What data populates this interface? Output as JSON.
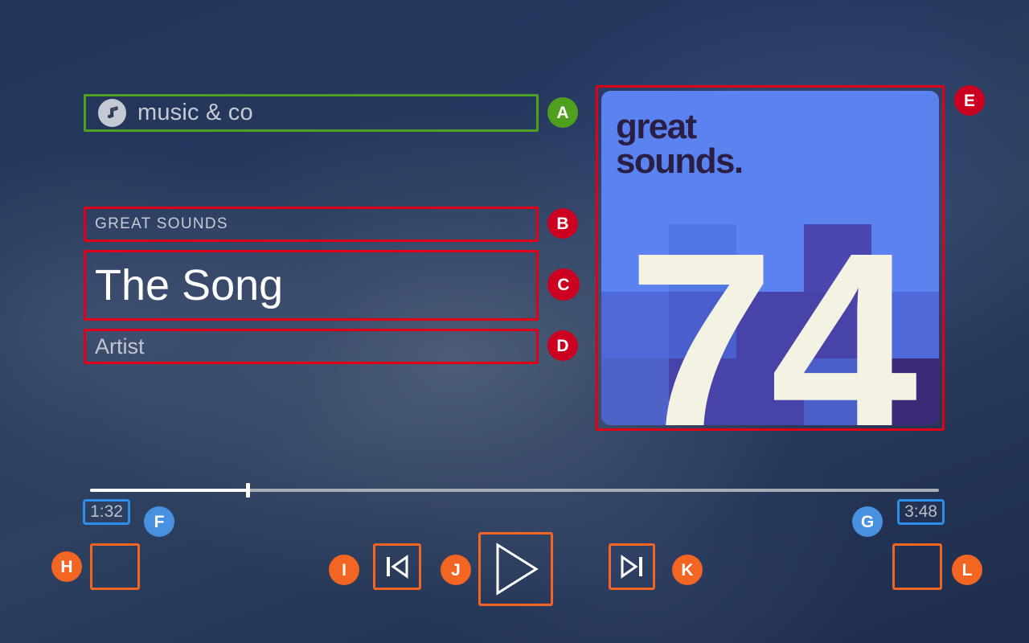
{
  "app": {
    "name_label": "music & co",
    "icon": "music-note-icon"
  },
  "now_playing": {
    "album": "GREAT SOUNDS",
    "title": "The Song",
    "artist": "Artist",
    "artwork": {
      "wordmark_line1": "great",
      "wordmark_line2": "sounds.",
      "number": "74",
      "base_color": "#5B83F0",
      "text_color": "#2A1E45",
      "number_color": "#F4F2E2",
      "tiles": [
        "#5B83F0",
        "#5B83F0",
        "#5B83F0",
        "#5B83F0",
        "#5B83F0",
        "#5B83F0",
        "#5B83F0",
        "#5B83F0",
        "#5B83F0",
        "#5B83F0",
        "#5B83F0",
        "#5077E4",
        "#5B83F0",
        "#4A47B0",
        "#5B83F0",
        "#4F69D8",
        "#4A5FCC",
        "#4843A8",
        "#4843A8",
        "#4F69D8",
        "#4E62C8",
        "#4843A8",
        "#4843A8",
        "#4A5FC8",
        "#3C2A78"
      ]
    }
  },
  "progress": {
    "current_time": "1:32",
    "total_time": "3:48",
    "percent": 18.6,
    "filled_color": "#FFFFFF",
    "remaining_color": "#A7ACB6"
  },
  "controls": {
    "shuffle": {
      "name": "shuffle-button",
      "icon": "blank-icon"
    },
    "previous": {
      "name": "previous-track-button",
      "icon": "skip-previous-icon"
    },
    "play": {
      "name": "play-button",
      "icon": "play-icon"
    },
    "next": {
      "name": "next-track-button",
      "icon": "skip-next-icon"
    },
    "repeat": {
      "name": "repeat-button",
      "icon": "blank-icon"
    }
  },
  "annotations": [
    {
      "id": "A",
      "label": "A",
      "color": "#4FA01E",
      "target": "app-name-label"
    },
    {
      "id": "B",
      "label": "B",
      "color": "#CC0020",
      "target": "album-name"
    },
    {
      "id": "C",
      "label": "C",
      "color": "#CC0020",
      "target": "track-title"
    },
    {
      "id": "D",
      "label": "D",
      "color": "#CC0020",
      "target": "artist-name"
    },
    {
      "id": "E",
      "label": "E",
      "color": "#CC0020",
      "target": "album-artwork"
    },
    {
      "id": "F",
      "label": "F",
      "color": "#4891E0",
      "target": "current-time"
    },
    {
      "id": "G",
      "label": "G",
      "color": "#4891E0",
      "target": "total-time"
    },
    {
      "id": "H",
      "label": "H",
      "color": "#F26522",
      "target": "shuffle-button"
    },
    {
      "id": "I",
      "label": "I",
      "color": "#F26522",
      "target": "previous-track-button"
    },
    {
      "id": "J",
      "label": "J",
      "color": "#F26522",
      "target": "play-button"
    },
    {
      "id": "K",
      "label": "K",
      "color": "#F26522",
      "target": "next-track-button"
    },
    {
      "id": "L",
      "label": "L",
      "color": "#F26522",
      "target": "repeat-button"
    }
  ]
}
